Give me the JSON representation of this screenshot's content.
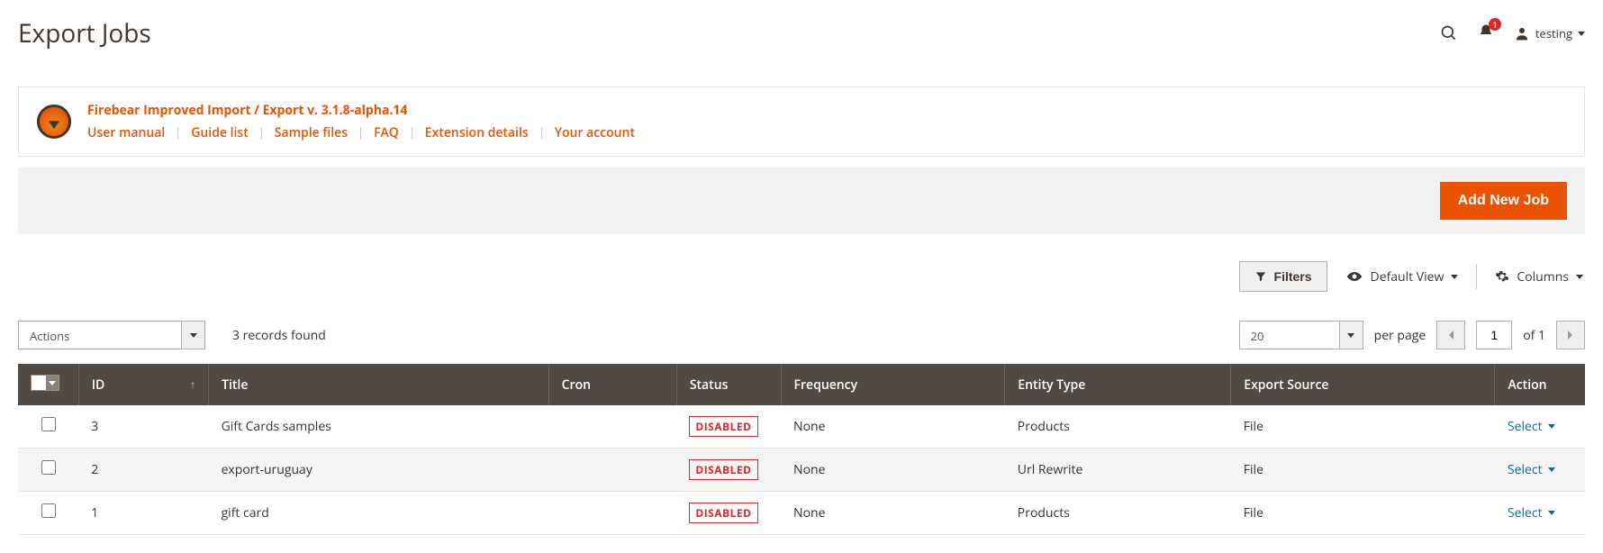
{
  "header": {
    "title": "Export Jobs",
    "notification_count": "1",
    "user_name": "testing"
  },
  "banner": {
    "title": "Firebear Improved Import / Export v. 3.1.8-alpha.14",
    "links": {
      "manual": "User manual",
      "guide": "Guide list",
      "samples": "Sample files",
      "faq": "FAQ",
      "ext": "Extension details",
      "account": "Your account"
    }
  },
  "actions": {
    "add_new": "Add New Job"
  },
  "toolbar": {
    "filters": "Filters",
    "default_view": "Default View",
    "columns": "Columns"
  },
  "grid_controls": {
    "actions_label": "Actions",
    "records_found": "3 records found",
    "per_page_value": "20",
    "per_page_label": "per page",
    "current_page": "1",
    "total_pages_label": "of 1"
  },
  "columns": {
    "id": "ID",
    "title": "Title",
    "cron": "Cron",
    "status": "Status",
    "frequency": "Frequency",
    "entity": "Entity Type",
    "source": "Export Source",
    "action": "Action"
  },
  "status_label": "DISABLED",
  "row_action_label": "Select",
  "rows": [
    {
      "id": "3",
      "title": "Gift Cards samples",
      "cron": "",
      "frequency": "None",
      "entity": "Products",
      "source": "File"
    },
    {
      "id": "2",
      "title": "export-uruguay",
      "cron": "",
      "frequency": "None",
      "entity": "Url Rewrite",
      "source": "File"
    },
    {
      "id": "1",
      "title": "gift card",
      "cron": "",
      "frequency": "None",
      "entity": "Products",
      "source": "File"
    }
  ]
}
